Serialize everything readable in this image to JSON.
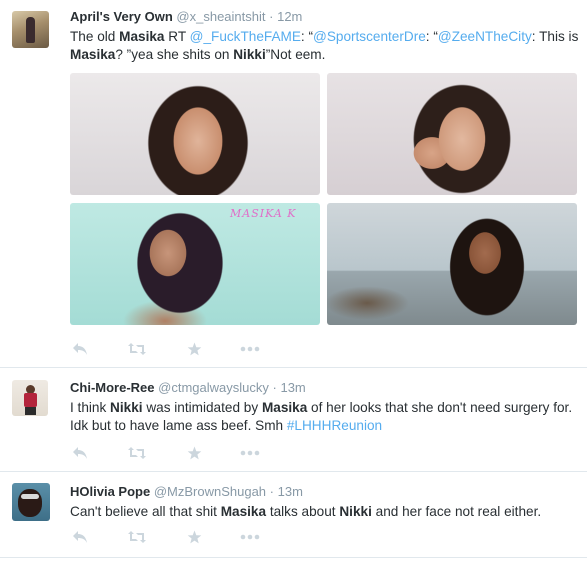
{
  "tweets": [
    {
      "name": "April's Very Own",
      "handle": "@x_sheaintshit",
      "sep": "·",
      "time": "12m",
      "text": {
        "p1": "The old ",
        "b1": "Masika",
        "p2": " RT ",
        "m1": "@_FuckTheFAME",
        "p3": ": “",
        "m2": "@SportscenterDre",
        "p4": ": “",
        "m3": "@ZeeNTheCity",
        "p5": ": This is ",
        "b2": "Masika",
        "p6": "?  ”yea she shits on ",
        "b3": "Nikki",
        "p7": "”Not eem."
      },
      "media_watermark": "MASIKA K"
    },
    {
      "name": "Chi-More-Ree",
      "handle": "@ctmgalwayslucky",
      "sep": "·",
      "time": "13m",
      "text": {
        "p1": "I think ",
        "b1": "Nikki",
        "p2": " was intimidated by ",
        "b2": "Masika",
        "p3": " of her looks that she don't need surgery for. Idk but to have lame ass beef. Smh ",
        "h1": "#LHHHReunion"
      }
    },
    {
      "name": "HOlivia Pope",
      "handle": "@MzBrownShugah",
      "sep": "·",
      "time": "13m",
      "text": {
        "p1": "Can't believe all that shit ",
        "b1": "Masika",
        "p2": " talks about ",
        "b2": "Nikki",
        "p3": " and her face not real either."
      }
    }
  ],
  "action_icons": [
    "reply-icon",
    "retweet-icon",
    "favorite-icon",
    "more-icon"
  ],
  "colors": {
    "link": "#55acee",
    "muted": "#8899a6",
    "text": "#292f33",
    "icon": "#ccd6dd",
    "divider": "#e1e8ed"
  }
}
